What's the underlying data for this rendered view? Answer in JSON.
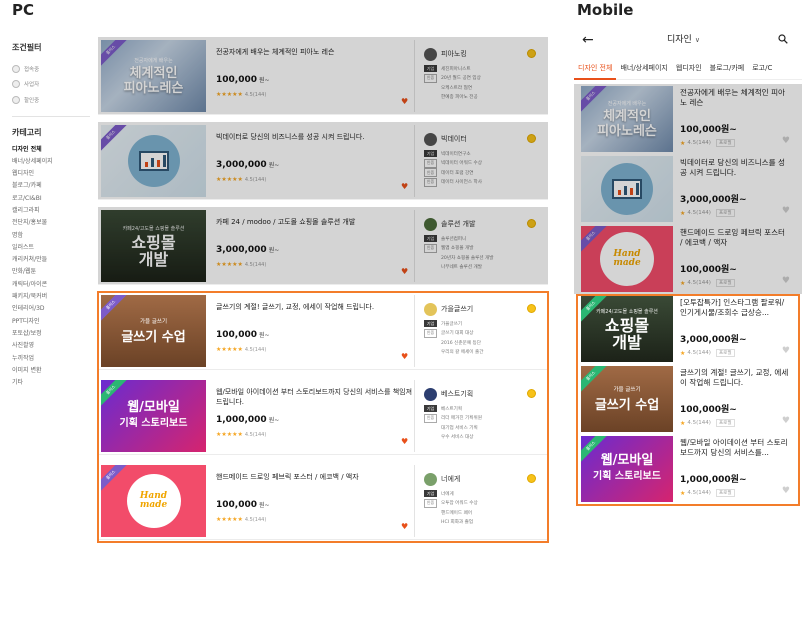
{
  "labels": {
    "pc": "PC",
    "mobile": "Mobile"
  },
  "sidebar": {
    "filter_title": "조건필터",
    "filters": [
      "접속중",
      "사업자",
      "할인중"
    ],
    "category_title": "카테고리",
    "categories": [
      "디자인 전체",
      "배너/상세페이지",
      "웹디자인",
      "블로그/카페",
      "로고/CI&BI",
      "캘리그라피",
      "전단지/홍보물",
      "명함",
      "일러스트",
      "캐리커쳐/만들",
      "만화/웹툰",
      "캐릭터/아이콘",
      "패키지/북커버",
      "인테리어/3D",
      "PPT디자인",
      "포토샵/보정",
      "사진촬영",
      "누끼작업",
      "이미지 변환",
      "기타"
    ]
  },
  "pc_items": [
    {
      "badge": "플러스",
      "name": "전공자에게 배우는 체계적인 피아노 레슨",
      "price": "100,000",
      "won": "원~",
      "rating": "4.5(144)",
      "seller": "피아노킹",
      "lines": [
        "세진피아니스트",
        "20년 월드 공연 입상",
        "오케스트라 협연",
        "한예종 피아노 전공"
      ],
      "thumb": {
        "small": "전공자에게 배우는",
        "big1": "체계적인",
        "big2": "피아노레슨"
      }
    },
    {
      "badge": "플러스",
      "name": "빅데이터로 당신의 비즈니스를 성공 시켜 드립니다.",
      "price": "3,000,000",
      "won": "원~",
      "rating": "4.5(144)",
      "seller": "빅데이터",
      "lines": [
        "빅데이터연구소",
        "빅데이터 어워드 수상",
        "데이터 포럼 강연",
        "데이터 사이언스 학사"
      ]
    },
    {
      "badge": "",
      "name": "카페 24 / modoo / 고도몰 쇼핑몰 솔루션 개발",
      "price": "3,000,000",
      "won": "원~",
      "rating": "4.5(144)",
      "seller": "솔루션 개발",
      "lines": [
        "솔루션컴퍼니",
        "웹앱 쇼핑몰 개발",
        "20년차 쇼핑몰 솔루션 개발",
        "나무네트 솔루션 개발"
      ],
      "thumb": {
        "small": "카페24/고도몰 쇼핑몰 솔루션",
        "big1": "쇼핑몰",
        "big2": "개발"
      }
    },
    {
      "badge": "플러스",
      "name": "글쓰기의 계절! 글쓰기, 교정, 에세이 작업해 드립니다.",
      "price": "100,000",
      "won": "원~",
      "rating": "4.5(144)",
      "seller": "가을글쓰기",
      "lines": [
        "가을글쓰기",
        "글쓰기 대회 대상",
        "2016 신춘문예 등단",
        "우리의 갈 에세이 출간"
      ],
      "thumb": {
        "small": "가을 글쓰기",
        "big1": "글쓰기 수업"
      }
    },
    {
      "badge": "플러스",
      "name": "웹/모바일 아이데이션 부터 스토리보드까지 당신의 서비스를 책임져 드립니다.",
      "price": "1,000,000",
      "won": "원~",
      "rating": "4.5(144)",
      "seller": "베스트기획",
      "lines": [
        "베스트기획",
        "리더 매거진 기획위원",
        "대기업 서비스 기획",
        "우수 서비스 대상"
      ],
      "thumb": {
        "big1": "웹/모바일",
        "big2": "기획 스토리보드"
      }
    },
    {
      "badge": "플러스",
      "name": "핸드메이드 드로잉 페브릭 포스터 / 에코백 / 액자",
      "price": "100,000",
      "won": "원~",
      "rating": "4.5(144)",
      "seller": "너에게",
      "lines": [
        "너에게",
        "오투잡 어워드 수상",
        "핸드메이드 페어",
        "HCI 회화과 졸업"
      ],
      "thumb": {
        "big1": "Hand",
        "big2": "made"
      }
    }
  ],
  "seller_tags": [
    "기업",
    "인증"
  ],
  "mobile": {
    "title": "디자인",
    "tabs": [
      "디자인 전체",
      "배너/상세페이지",
      "웹디자인",
      "블로그/카페",
      "로고/C"
    ],
    "items": [
      {
        "name": "전공자에게 배우는 체계적인 피아노 레슨",
        "price": "100,000원~",
        "rating": "4.5(144)",
        "tag": "프로필"
      },
      {
        "name": "빅데이터로 당신의 비즈니스를 성공 시켜 드립니다.",
        "price": "3,000,000원~",
        "rating": "4.5(144)",
        "tag": "프로필"
      },
      {
        "name": "핸드메이드 드로잉 페브릭 포스터 / 에코백 / 액자",
        "price": "100,000원~",
        "rating": "4.5(144)",
        "tag": "프로필"
      },
      {
        "name": "[오투잡특가] 인스타그램 팔로워/인기게시물/조회수 급상승...",
        "price": "3,000,000원~",
        "rating": "4.5(144)",
        "tag": "프로필"
      },
      {
        "name": "글쓰기의 계절! 글쓰기, 교정, 에세이 작업해 드립니다.",
        "price": "100,000원~",
        "rating": "4.5(144)",
        "tag": "프로필"
      },
      {
        "name": "웹/모바일 아이데이션 부터 스토리보드까지 당신의 서비스를...",
        "price": "1,000,000원~",
        "rating": "4.5(144)",
        "tag": "프로필"
      }
    ]
  },
  "colors": {
    "accent": "#e8501a",
    "highlight_frame": "#f37d2a",
    "star": "#f5a623"
  }
}
